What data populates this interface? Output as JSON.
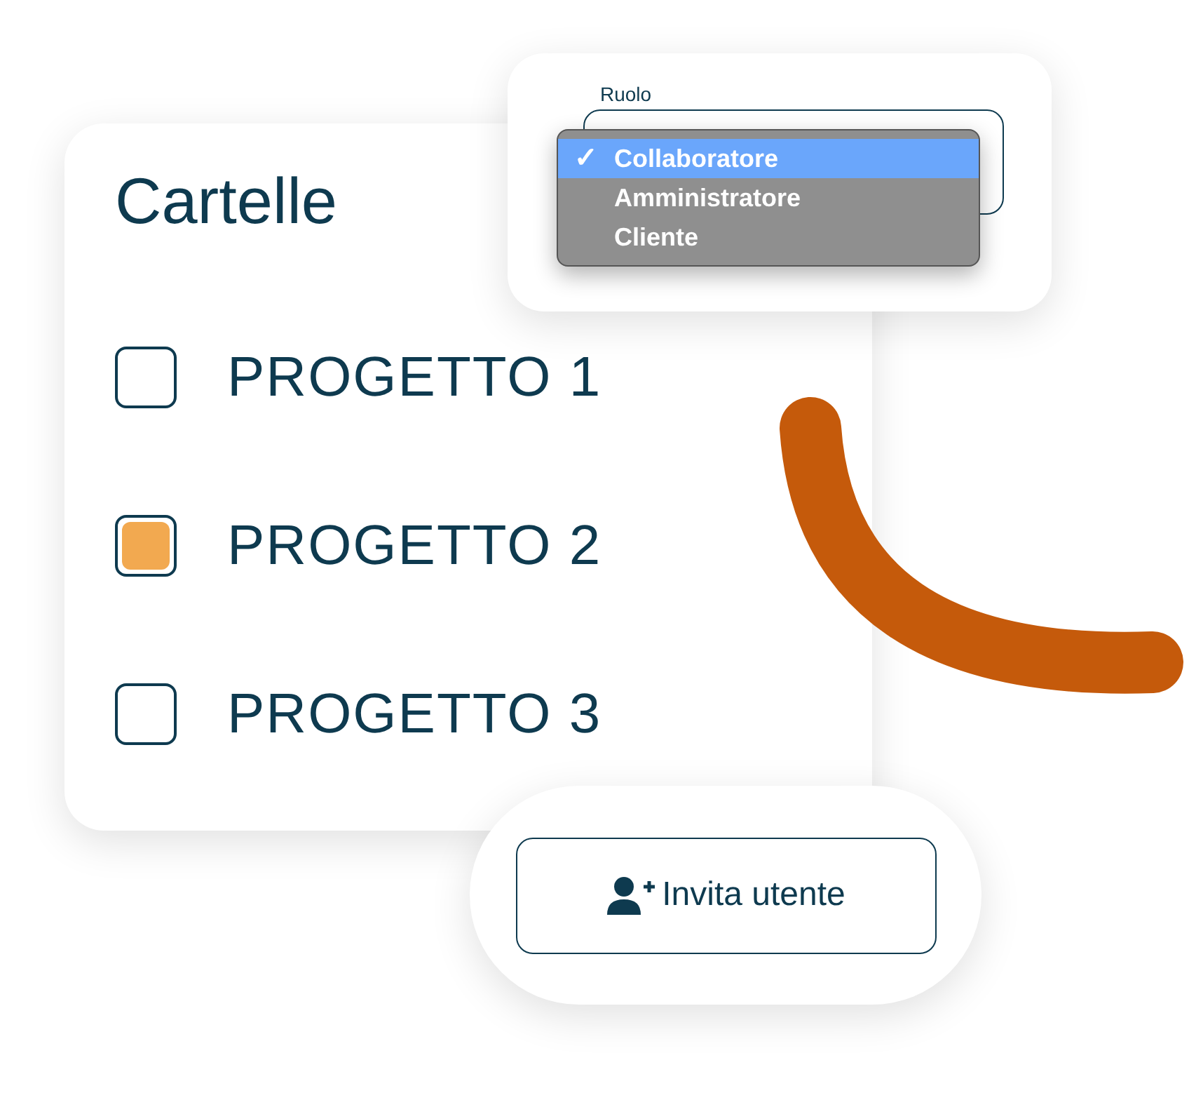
{
  "folders_card": {
    "title": "Cartelle",
    "items": [
      {
        "label": "PROGETTO 1",
        "checked": false
      },
      {
        "label": "PROGETTO 2",
        "checked": true
      },
      {
        "label": "PROGETTO 3",
        "checked": false
      }
    ]
  },
  "role_card": {
    "label": "Ruolo",
    "check_mark": "✓",
    "options": [
      {
        "label": "Collaboratore",
        "selected": true
      },
      {
        "label": "Amministratore",
        "selected": false
      },
      {
        "label": "Cliente",
        "selected": false
      }
    ]
  },
  "invite_card": {
    "button": "Invita utente"
  }
}
